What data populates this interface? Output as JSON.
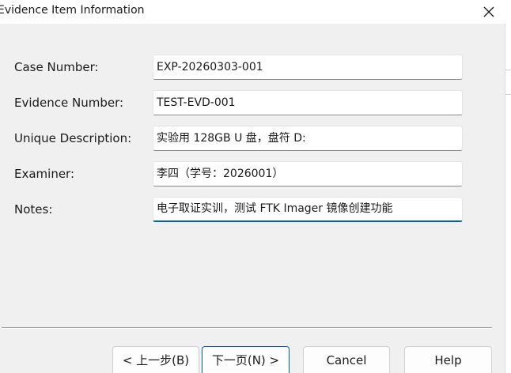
{
  "window": {
    "title": "Evidence Item Information"
  },
  "form": {
    "case_number": {
      "label": "Case Number:",
      "value": "EXP-20260303-001"
    },
    "evidence_number": {
      "label": "Evidence Number:",
      "value": "TEST-EVD-001"
    },
    "unique_description": {
      "label": "Unique Description:",
      "value": "实验用 128GB U 盘，盘符 D:"
    },
    "examiner": {
      "label": "Examiner:",
      "value": "李四（学号：2026001）"
    },
    "notes": {
      "label": "Notes:",
      "value": "电子取证实训，测试 FTK Imager 镜像创建功能"
    }
  },
  "buttons": {
    "back": "< 上一步(B)",
    "next": "下一页(N) >",
    "cancel": "Cancel",
    "help": "Help"
  },
  "colors": {
    "focus_accent": "#005fb8",
    "dialog_background": "#f0f0f0"
  },
  "icons": {
    "close": "close-icon"
  }
}
